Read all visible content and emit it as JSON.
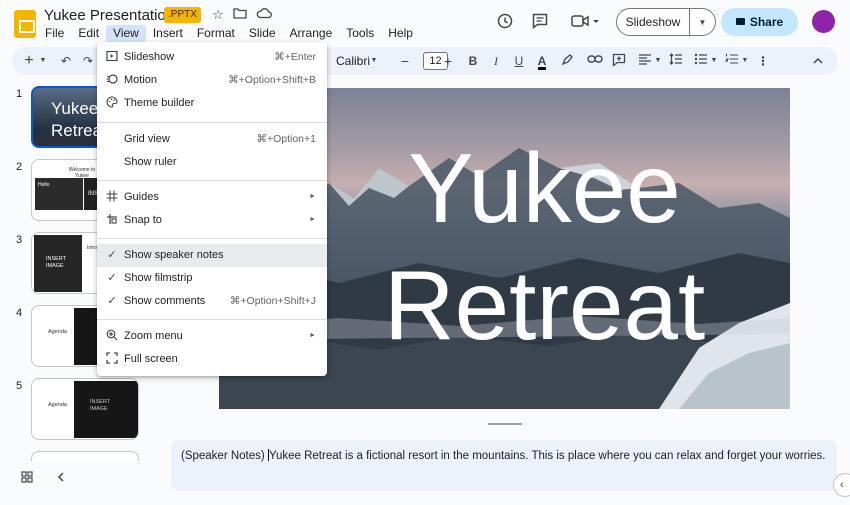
{
  "header": {
    "doc_title": "Yukee Presentation",
    "badge": ".PPTX",
    "slideshow_label": "Slideshow",
    "share_label": "Share"
  },
  "menubar": [
    "File",
    "Edit",
    "View",
    "Insert",
    "Format",
    "Slide",
    "Arrange",
    "Tools",
    "Help"
  ],
  "toolbar": {
    "font_name": "Calibri",
    "font_size": "12"
  },
  "filmstrip": {
    "numbers": [
      "1",
      "2",
      "3",
      "4",
      "5"
    ],
    "slide1_title_line1": "Yukee",
    "slide1_title_line2": "Retrea",
    "slide2_text": "Welcome to Yukee",
    "slide2_small": "Hello",
    "slide2_insert": "INSE",
    "slide3_insert": "INSERT IMAGE",
    "slide3_small": "Intro",
    "slide4_agenda": "Agenda",
    "slide5_agenda": "Agenda",
    "slide5_insert": "INSERT IMAGE"
  },
  "slide": {
    "title_line1": "Yukee",
    "title_line2": "Retreat"
  },
  "notes": {
    "before_cursor": "(Speaker Notes) ",
    "after_cursor": "Yukee Retreat is a fictional resort in the mountains. This is place where you can relax and forget your worries."
  },
  "view_menu": {
    "items": [
      {
        "label": "Slideshow",
        "shortcut": "⌘+Enter",
        "icon": "slideshow-icon",
        "checked": false,
        "submenu": false
      },
      {
        "label": "Motion",
        "shortcut": "⌘+Option+Shift+B",
        "icon": "motion-icon",
        "checked": false,
        "submenu": false
      },
      {
        "label": "Theme builder",
        "shortcut": "",
        "icon": "palette-icon",
        "checked": false,
        "submenu": false
      },
      {
        "label": "Grid view",
        "shortcut": "⌘+Option+1",
        "icon": "",
        "checked": false,
        "submenu": false
      },
      {
        "label": "Show ruler",
        "shortcut": "",
        "icon": "",
        "checked": false,
        "submenu": false
      },
      {
        "label": "Guides",
        "shortcut": "",
        "icon": "guides-icon",
        "checked": false,
        "submenu": true
      },
      {
        "label": "Snap to",
        "shortcut": "",
        "icon": "snap-icon",
        "checked": false,
        "submenu": true
      },
      {
        "label": "Show speaker notes",
        "shortcut": "",
        "icon": "",
        "checked": true,
        "submenu": false
      },
      {
        "label": "Show filmstrip",
        "shortcut": "",
        "icon": "",
        "checked": true,
        "submenu": false
      },
      {
        "label": "Show comments",
        "shortcut": "⌘+Option+Shift+J",
        "icon": "",
        "checked": true,
        "submenu": false
      },
      {
        "label": "Zoom menu",
        "shortcut": "",
        "icon": "zoom-icon",
        "checked": false,
        "submenu": true
      },
      {
        "label": "Full screen",
        "shortcut": "",
        "icon": "fullscreen-icon",
        "checked": false,
        "submenu": false
      }
    ]
  },
  "colors": {
    "accent": "#0b57d0",
    "share_bg": "#c2e7ff",
    "logo": "#f4b400",
    "avatar": "#8e24aa"
  }
}
